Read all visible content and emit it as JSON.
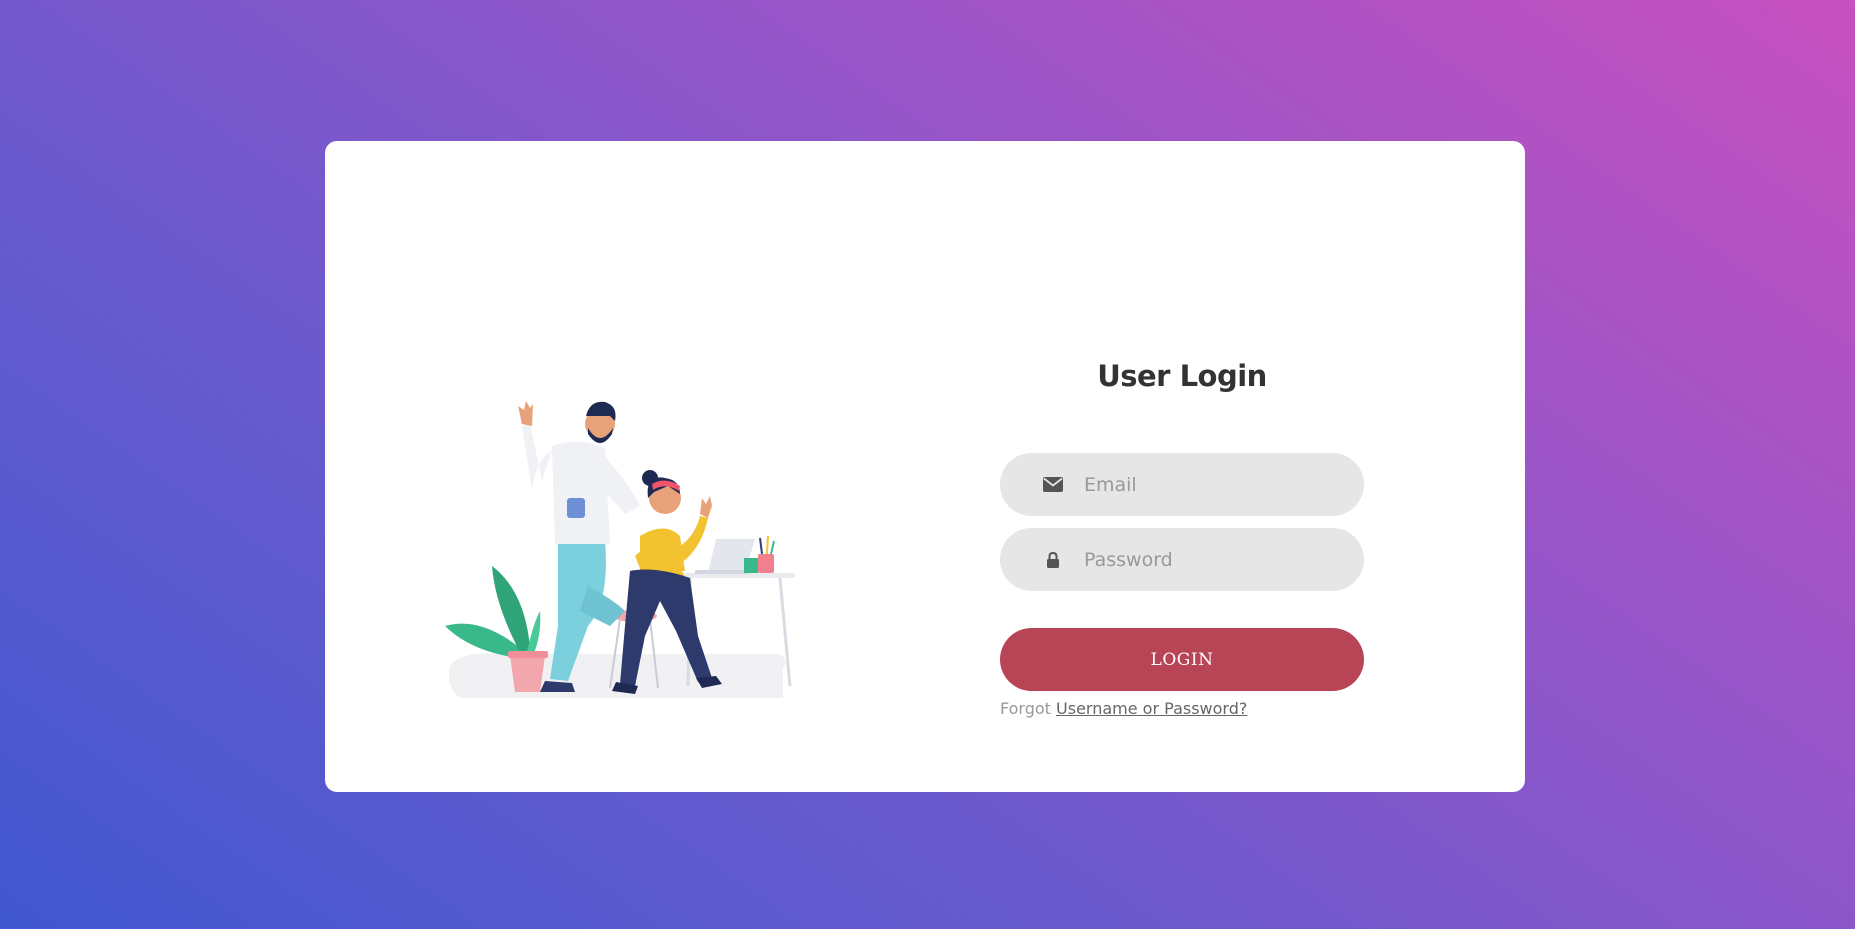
{
  "login": {
    "title": "User Login",
    "email": {
      "placeholder": "Email",
      "value": "",
      "icon": "envelope-icon"
    },
    "password": {
      "placeholder": "Password",
      "value": "",
      "icon": "lock-icon"
    },
    "submit_label": "LOGIN",
    "forgot_prefix": "Forgot",
    "forgot_link": "Username or Password?"
  },
  "colors": {
    "background_gradient_start": "#4158d0",
    "background_gradient_end": "#c850c0",
    "card": "#ffffff",
    "input_background": "#e6e6e6",
    "button": "#b84556"
  }
}
